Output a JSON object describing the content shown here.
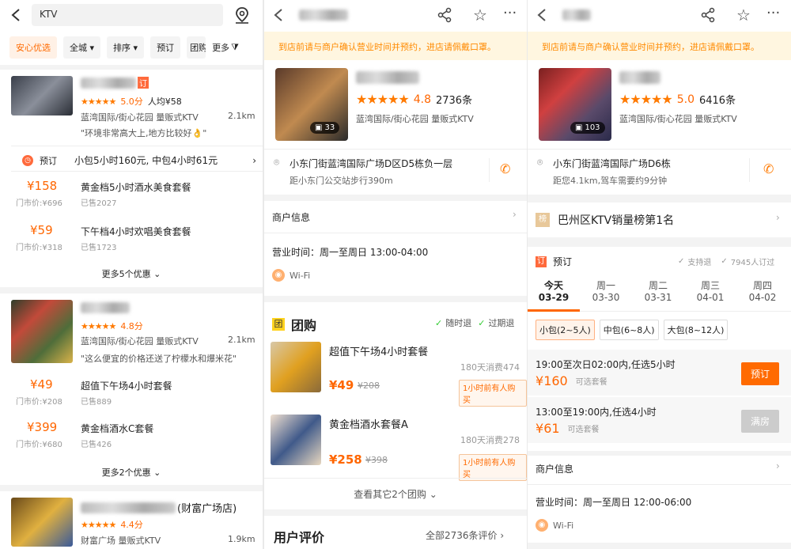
{
  "colors": {
    "accent": "#ff6600",
    "notice_bg": "#fff6e0",
    "star": "#ff7a00"
  },
  "p1": {
    "search": {
      "value": "KTV"
    },
    "filters": [
      "安心优选",
      "全城",
      "排序",
      "预订",
      "团购"
    ],
    "more": "更多",
    "shops": [
      {
        "tag": "订",
        "rating": "5.0分",
        "avg": "人均¥58",
        "area": "蓝湾国际/街心花园 量贩式KTV",
        "dist": "2.1km",
        "review": "\"环境非常高大上,地方比较好👌\"",
        "book_label": "预订",
        "book_text": "小包5小时160元, 中包4小时61元",
        "deals": [
          {
            "price": "¥158",
            "orig": "门市价:¥696",
            "title": "黄金档5小时酒水美食套餐",
            "sold": "已售2027"
          },
          {
            "price": "¥59",
            "orig": "门市价:¥318",
            "title": "下午档4小时欢唱美食套餐",
            "sold": "已售1723"
          }
        ],
        "more": "更多5个优惠"
      },
      {
        "rating": "4.8分",
        "area": "蓝湾国际/街心花园 量贩式KTV",
        "dist": "2.1km",
        "review": "\"这么便宜的价格还送了柠檬水和爆米花\"",
        "deals": [
          {
            "price": "¥49",
            "orig": "门市价:¥208",
            "title": "超值下午场4小时套餐",
            "sold": "已售889"
          },
          {
            "price": "¥399",
            "orig": "门市价:¥680",
            "title": "黄金档酒水C套餐",
            "sold": "已售426"
          }
        ],
        "more": "更多2个优惠"
      },
      {
        "name_suffix": "(财富广场店)",
        "rating": "4.4分",
        "area": "财富广场 量贩式KTV",
        "dist": "1.9km"
      }
    ]
  },
  "p2": {
    "notice": "到店前请与商户确认营业时间并预约，进店请佩戴口罩。",
    "rating": "4.8",
    "reviews": "2736条",
    "area": "蓝湾国际/街心花园 量贩式KTV",
    "photos": "33",
    "address": "小东门街蓝湾国际广场D区D5栋负一层",
    "address_sub": "距小东门公交站步行390m",
    "merchant_info": "商户信息",
    "hours": "营业时间：周一至周日 13:00-04:00",
    "wifi": "Wi-Fi",
    "group": {
      "icon": "团",
      "title": "团购",
      "flag1": "随时退",
      "flag2": "过期退",
      "deals": [
        {
          "title": "超值下午场4小时套餐",
          "sold": "180天消费474",
          "price": "¥49",
          "orig": "¥208",
          "tag": "1小时前有人购买"
        },
        {
          "title": "黄金档酒水套餐A",
          "sold": "180天消费278",
          "price": "¥258",
          "orig": "¥398",
          "tag": "1小时前有人购买"
        }
      ],
      "more": "查看其它2个团购"
    },
    "review_title": "用户评价",
    "review_all": "全部2736条评价"
  },
  "p3": {
    "notice": "到店前请与商户确认营业时间并预约，进店请佩戴口罩。",
    "rating": "5.0",
    "reviews": "6416条",
    "area": "蓝湾国际/街心花园 量贩式KTV",
    "photos": "103",
    "address": "小东门街蓝湾国际广场D6栋",
    "address_sub": "距您4.1km,驾车需要约9分钟",
    "rank_icon": "榜",
    "rank": "巴州区KTV销量榜第1名",
    "book": {
      "icon": "订",
      "title": "预订",
      "flag1": "支持退",
      "flag2": "7945人订过",
      "days": [
        {
          "d": "今天",
          "date": "03-29"
        },
        {
          "d": "周一",
          "date": "03-30"
        },
        {
          "d": "周二",
          "date": "03-31"
        },
        {
          "d": "周三",
          "date": "04-01"
        },
        {
          "d": "周四",
          "date": "04-02"
        }
      ],
      "rooms": [
        "小包(2~5人)",
        "中包(6~8人)",
        "大包(8~12人)"
      ],
      "slots": [
        {
          "time": "19:00至次日02:00内,任选5小时",
          "price": "160",
          "note": "可选套餐",
          "btn": "预订"
        },
        {
          "time": "13:00至19:00内,任选4小时",
          "price": "61",
          "note": "可选套餐",
          "btn": "满房"
        }
      ]
    },
    "merchant_info": "商户信息",
    "hours": "营业时间：周一至周日 12:00-06:00",
    "wifi": "Wi-Fi"
  }
}
